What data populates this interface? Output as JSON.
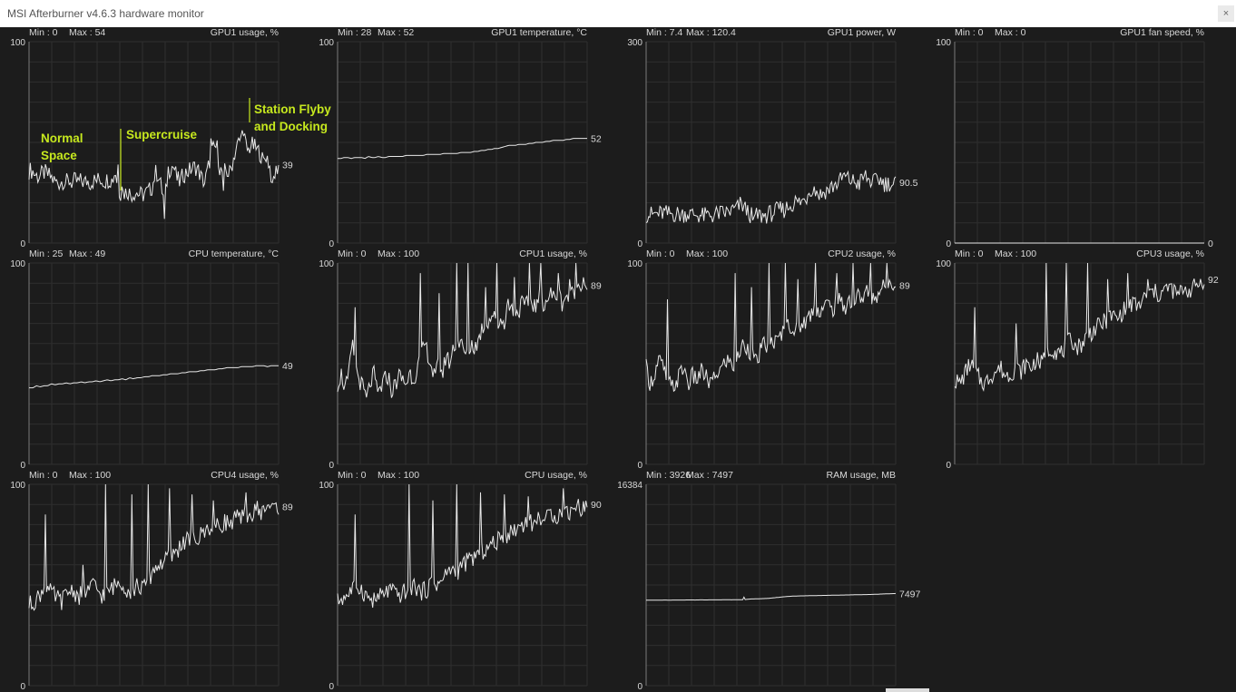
{
  "window": {
    "title": "MSI Afterburner v4.6.3 hardware monitor",
    "close_glyph": "×"
  },
  "colors": {
    "background": "#1c1c1c",
    "grid": "#2f2f2f",
    "axis": "#7a7a7a",
    "line": "#e8e8e8",
    "text": "#d8d8d8",
    "annotation": "#c6e81e"
  },
  "graphs": [
    {
      "id": "gpu1-usage",
      "title": "GPU1 usage, %",
      "min_label": "Min : 0",
      "max_label": "Max : 54",
      "y_top": "100",
      "y_bottom": "0",
      "ymin": 0,
      "ymax": 100,
      "current": 39,
      "current_label": "39",
      "baseline": [
        36,
        36,
        34,
        33,
        34,
        35,
        34,
        33,
        31,
        30,
        30,
        31,
        30,
        31,
        30,
        31,
        30,
        31,
        30,
        31,
        30,
        31,
        31,
        32,
        31,
        31,
        32,
        31,
        36,
        26,
        25,
        25,
        26,
        24,
        25,
        25,
        24,
        24,
        25,
        26,
        28,
        35,
        34,
        27,
        20,
        34,
        38,
        38,
        32,
        30,
        34,
        35,
        36,
        37,
        38,
        36,
        32,
        30,
        36,
        44,
        47,
        48,
        36,
        35,
        36,
        34,
        40,
        46,
        50,
        52,
        51,
        45,
        49,
        48,
        46,
        45,
        40,
        44,
        39,
        30,
        35,
        39
      ],
      "spikes": [
        [
          29,
          39
        ],
        [
          30,
          28
        ],
        [
          44,
          12
        ],
        [
          45,
          38
        ],
        [
          59,
          52
        ],
        [
          63,
          26
        ],
        [
          69,
          56
        ],
        [
          79,
          30
        ]
      ],
      "annotations": [
        {
          "id": "normal-space",
          "lines": [
            "Normal",
            "Space"
          ]
        },
        {
          "id": "supercruise",
          "lines": [
            "Supercruise"
          ]
        },
        {
          "id": "station",
          "lines": [
            "Station Flyby",
            "and Docking"
          ]
        }
      ]
    },
    {
      "id": "gpu1-temperature",
      "title": "GPU1 temperature, °C",
      "min_label": "Min : 28",
      "max_label": "Max : 52",
      "y_top": "100",
      "y_bottom": "0",
      "ymin": 0,
      "ymax": 100,
      "current": 52,
      "current_label": "52",
      "baseline": [
        42,
        42,
        42.5,
        42.5,
        42,
        42.5,
        42.5,
        42.5,
        42,
        43,
        42.5,
        42.5,
        43,
        42.5,
        42.5,
        43,
        43,
        43,
        43,
        43,
        43.5,
        43.5,
        43.5,
        43.5,
        43.5,
        43.5,
        44,
        44,
        44,
        44,
        44,
        44.5,
        44.5,
        44.5,
        44.5,
        44.5,
        45,
        45,
        45,
        45,
        45.5,
        45.5,
        46,
        46,
        46.5,
        46.5,
        47,
        47,
        47.5,
        48,
        48.5,
        48.5,
        48.5,
        49,
        49,
        49,
        49.5,
        49.5,
        50,
        50,
        50,
        50.5,
        50.5,
        51,
        51,
        51,
        51,
        51.5,
        51.5,
        52,
        52,
        52,
        52,
        52
      ],
      "spikes": []
    },
    {
      "id": "gpu1-power",
      "title": "GPU1 power, W",
      "min_label": "Min : 7.4",
      "max_label": "Max : 120.4",
      "y_top": "300",
      "y_bottom": "0",
      "ymin": 0,
      "ymax": 300,
      "current": 90.5,
      "current_label": "90.5",
      "baseline": [
        43,
        43,
        42,
        44,
        43,
        44,
        45,
        43,
        44,
        43,
        44,
        42,
        43,
        44,
        44,
        42,
        43,
        42,
        41,
        40,
        41,
        42,
        41,
        43,
        44,
        44,
        45,
        46,
        48,
        50,
        52,
        58,
        55,
        48,
        44,
        38,
        39,
        42,
        40,
        41,
        43,
        44,
        46,
        48,
        50,
        49,
        52,
        55,
        58,
        62,
        60,
        62,
        64,
        70,
        82,
        80,
        78,
        72,
        74,
        78,
        80,
        84,
        86,
        90,
        94,
        100,
        96,
        94,
        92,
        90,
        88,
        96,
        100,
        94,
        92,
        90,
        96,
        94,
        90,
        88,
        90,
        86,
        90
      ],
      "spikes": [
        [
          35,
          34
        ],
        [
          53,
          72
        ]
      ]
    },
    {
      "id": "gpu1-fan-speed",
      "title": "GPU1 fan speed, %",
      "min_label": "Min : 0",
      "max_label": "Max : 0",
      "y_top": "100",
      "y_bottom": "0",
      "ymin": 0,
      "ymax": 100,
      "current": 0,
      "current_label": "0",
      "baseline": [
        0,
        0
      ],
      "spikes": []
    },
    {
      "id": "cpu-temperature",
      "title": "CPU temperature, °C",
      "min_label": "Min : 25",
      "max_label": "Max : 49",
      "y_top": "100",
      "y_bottom": "0",
      "ymin": 0,
      "ymax": 100,
      "current": 49,
      "current_label": "49",
      "baseline": [
        38,
        38,
        39,
        38.5,
        39,
        39,
        40,
        39.5,
        40,
        40,
        40.5,
        40,
        40.5,
        40.5,
        41,
        40.5,
        41,
        41,
        41.5,
        41,
        41.5,
        42,
        41.5,
        42,
        42,
        42.5,
        42,
        43,
        42.5,
        43,
        43,
        43.5,
        43.5,
        44,
        44,
        44,
        44.5,
        44.5,
        45,
        45,
        45,
        45.5,
        45.5,
        46,
        46,
        46,
        46.5,
        46.5,
        47,
        47,
        47,
        47.5,
        47.5,
        48,
        48,
        48,
        48,
        48.5,
        48.5,
        48.5,
        48.5,
        49,
        49,
        49,
        48.5,
        49,
        49,
        49
      ],
      "spikes": []
    },
    {
      "id": "cpu1-usage",
      "title": "CPU1 usage, %",
      "min_label": "Min : 0",
      "max_label": "Max : 100",
      "y_top": "100",
      "y_bottom": "0",
      "ymin": 0,
      "ymax": 100,
      "current": 89,
      "current_label": "89",
      "baseline": [
        40,
        45,
        38,
        42,
        60,
        48,
        42,
        38,
        32,
        40,
        45,
        35,
        38,
        42,
        44,
        36,
        40,
        44,
        42,
        40,
        46,
        42,
        48,
        52,
        60,
        55,
        48,
        42,
        52,
        44,
        55,
        50,
        58,
        62,
        60,
        56,
        52,
        60,
        58,
        62,
        68,
        70,
        72,
        75,
        68,
        72,
        70,
        80,
        78,
        74,
        76,
        80,
        78,
        82,
        80,
        78,
        84,
        80,
        82,
        85,
        82,
        86,
        80,
        84,
        82,
        85,
        88,
        90,
        92,
        89
      ],
      "spikes": [
        [
          5,
          78
        ],
        [
          23,
          95
        ],
        [
          28,
          85
        ],
        [
          33,
          100
        ],
        [
          36,
          100
        ],
        [
          41,
          88
        ],
        [
          44,
          100
        ],
        [
          49,
          93
        ],
        [
          53,
          100
        ],
        [
          56,
          100
        ],
        [
          61,
          95
        ],
        [
          64,
          92
        ],
        [
          66,
          100
        ]
      ]
    },
    {
      "id": "cpu2-usage",
      "title": "CPU2 usage, %",
      "min_label": "Min : 0",
      "max_label": "Max : 100",
      "y_top": "100",
      "y_bottom": "0",
      "ymin": 0,
      "ymax": 100,
      "current": 89,
      "current_label": "89",
      "baseline": [
        48,
        40,
        45,
        52,
        48,
        42,
        38,
        40,
        45,
        48,
        40,
        44,
        42,
        46,
        44,
        40,
        42,
        46,
        48,
        52,
        50,
        48,
        55,
        60,
        58,
        55,
        50,
        56,
        60,
        58,
        62,
        60,
        65,
        68,
        70,
        66,
        68,
        70,
        72,
        75,
        78,
        76,
        78,
        80,
        76,
        82,
        80,
        78,
        82,
        80,
        84,
        82,
        86,
        84,
        82,
        86,
        88,
        90,
        92,
        89
      ],
      "spikes": [
        [
          5,
          82
        ],
        [
          21,
          95
        ],
        [
          25,
          88
        ],
        [
          29,
          100
        ],
        [
          33,
          100
        ],
        [
          36,
          92
        ],
        [
          40,
          100
        ],
        [
          45,
          95
        ],
        [
          49,
          100
        ],
        [
          53,
          100
        ],
        [
          57,
          100
        ]
      ]
    },
    {
      "id": "cpu3-usage",
      "title": "CPU3 usage, %",
      "min_label": "Min : 0",
      "max_label": "Max : 100",
      "y_top": "100",
      "y_bottom": "0",
      "ymin": 0,
      "ymax": 100,
      "current": 92,
      "current_label": "92",
      "baseline": [
        42,
        40,
        45,
        50,
        46,
        42,
        40,
        44,
        46,
        48,
        44,
        45,
        48,
        46,
        50,
        48,
        52,
        50,
        54,
        58,
        56,
        55,
        60,
        62,
        58,
        60,
        64,
        66,
        68,
        70,
        72,
        74,
        72,
        76,
        78,
        80,
        78,
        82,
        84,
        86,
        84,
        86,
        88,
        86,
        84,
        88,
        86,
        88,
        90,
        92
      ],
      "spikes": [
        [
          4,
          78
        ],
        [
          12,
          70
        ],
        [
          18,
          100
        ],
        [
          22,
          100
        ],
        [
          26,
          100
        ],
        [
          30,
          92
        ],
        [
          34,
          95
        ],
        [
          38,
          92
        ]
      ]
    },
    {
      "id": "cpu4-usage",
      "title": "CPU4 usage, %",
      "min_label": "Min : 0",
      "max_label": "Max : 100",
      "y_top": "100",
      "y_bottom": "0",
      "ymin": 0,
      "ymax": 100,
      "current": 89,
      "current_label": "89",
      "baseline": [
        40,
        42,
        45,
        50,
        46,
        44,
        42,
        46,
        48,
        44,
        46,
        48,
        50,
        46,
        44,
        48,
        50,
        52,
        48,
        46,
        50,
        48,
        52,
        58,
        60,
        62,
        64,
        66,
        70,
        72,
        74,
        72,
        76,
        78,
        80,
        78,
        82,
        80,
        84,
        82,
        86,
        84,
        88,
        86,
        90,
        88,
        89
      ],
      "spikes": [
        [
          3,
          85
        ],
        [
          10,
          60
        ],
        [
          14,
          100
        ],
        [
          19,
          95
        ],
        [
          22,
          100
        ],
        [
          26,
          98
        ],
        [
          30,
          95
        ],
        [
          34,
          92
        ],
        [
          40,
          96
        ]
      ]
    },
    {
      "id": "cpu-usage",
      "title": "CPU usage, %",
      "min_label": "Min : 0",
      "max_label": "Max : 100",
      "y_top": "100",
      "y_bottom": "0",
      "ymin": 0,
      "ymax": 100,
      "current": 90,
      "current_label": "90",
      "baseline": [
        42,
        44,
        46,
        50,
        48,
        44,
        42,
        44,
        46,
        48,
        44,
        46,
        48,
        50,
        46,
        48,
        52,
        50,
        54,
        58,
        56,
        60,
        62,
        64,
        66,
        68,
        70,
        72,
        74,
        76,
        78,
        80,
        82,
        80,
        84,
        82,
        86,
        84,
        88,
        86,
        90,
        88,
        90
      ],
      "spikes": [
        [
          3,
          85
        ],
        [
          12,
          100
        ],
        [
          16,
          92
        ],
        [
          20,
          100
        ],
        [
          24,
          96
        ],
        [
          28,
          95
        ],
        [
          32,
          94
        ],
        [
          38,
          98
        ]
      ]
    },
    {
      "id": "ram-usage",
      "title": "RAM usage, MB",
      "min_label": "Min : 3926",
      "max_label": "Max : 7497",
      "y_top": "16384",
      "y_bottom": "0",
      "ymin": 0,
      "ymax": 16384,
      "current": 7497,
      "current_label": "7497",
      "baseline": [
        6950,
        6960,
        6955,
        6965,
        6960,
        6970,
        6965,
        6975,
        6970,
        6980,
        6975,
        6985,
        6980,
        6990,
        6985,
        6995,
        6990,
        7050,
        7060,
        7080,
        7100,
        7150,
        7200,
        7250,
        7280,
        7300,
        7310,
        7320,
        7330,
        7340,
        7350,
        7360,
        7370,
        7380,
        7390,
        7400,
        7410,
        7420,
        7440,
        7460,
        7480,
        7497
      ],
      "spikes": [
        [
          16,
          7200
        ]
      ]
    }
  ]
}
